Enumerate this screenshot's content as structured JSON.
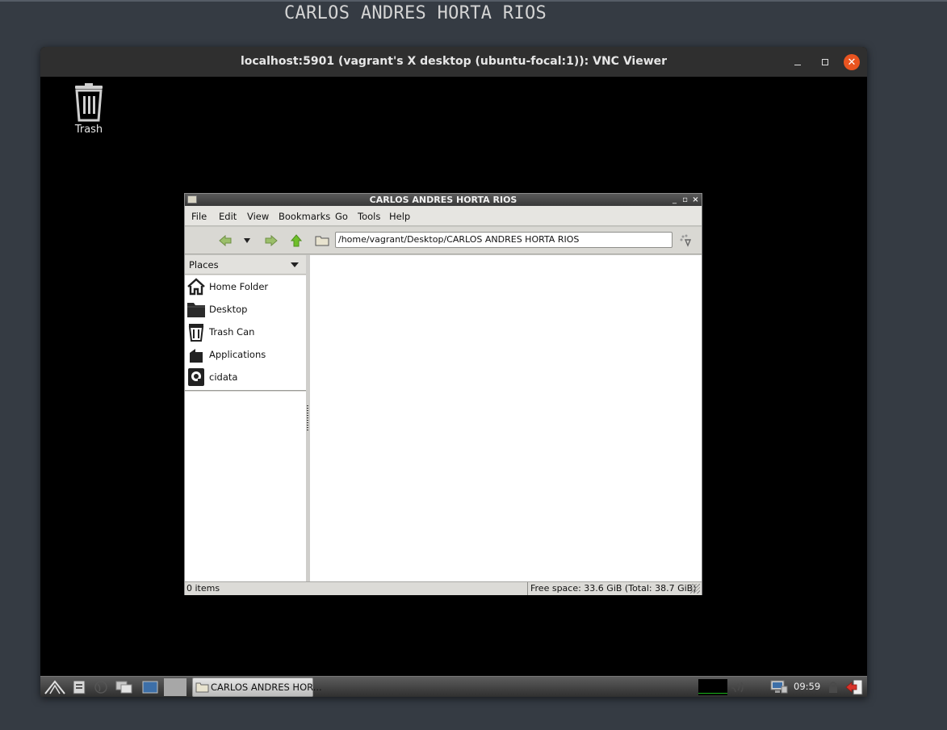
{
  "host": {
    "title": "CARLOS ANDRES HORTA RIOS"
  },
  "vnc": {
    "title": "localhost:5901 (vagrant's X desktop (ubuntu-focal:1)): VNC Viewer",
    "minimize_icon": "minimize-icon",
    "maximize_icon": "maximize-icon",
    "close_icon": "close-icon",
    "accent": "#e95420"
  },
  "desktop": {
    "icons": [
      {
        "label": "Trash",
        "icon": "trash-icon"
      }
    ]
  },
  "file_manager": {
    "title": "CARLOS ANDRES HORTA RIOS",
    "menu": [
      "File",
      "Edit",
      "View",
      "Bookmarks",
      "Go",
      "Tools",
      "Help"
    ],
    "toolbar": {
      "back_icon": "back-arrow-icon",
      "history_icon": "history-dropdown-icon",
      "forward_icon": "forward-arrow-icon",
      "up_icon": "up-arrow-icon",
      "folder_icon": "folder-icon",
      "go_icon": "go-icon"
    },
    "path": "/home/vagrant/Desktop/CARLOS ANDRES HORTA RIOS",
    "sidebar": {
      "header": "Places",
      "items": [
        {
          "label": "Home Folder",
          "icon": "home-icon"
        },
        {
          "label": "Desktop",
          "icon": "folder-icon"
        },
        {
          "label": "Trash Can",
          "icon": "trash-icon"
        },
        {
          "label": "Applications",
          "icon": "applications-icon"
        },
        {
          "label": "cidata",
          "icon": "drive-icon"
        }
      ]
    },
    "status": {
      "items": "0 items",
      "free_space": "Free space: 33.6 GiB (Total: 38.7 GiB)"
    }
  },
  "panel": {
    "task_label": "CARLOS ANDRES HOR...",
    "clock": "09:59"
  }
}
